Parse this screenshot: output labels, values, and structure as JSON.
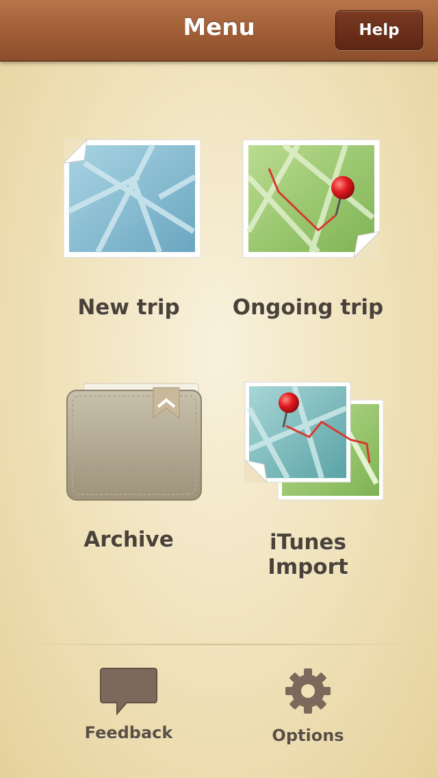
{
  "header": {
    "title": "Menu",
    "help_label": "Help"
  },
  "menu": {
    "new_trip": "New trip",
    "ongoing_trip": "Ongoing trip",
    "archive": "Archive",
    "itunes_import": "iTunes Import"
  },
  "toolbar": {
    "feedback": "Feedback",
    "options": "Options"
  },
  "icons": {
    "new_trip": "blank-map-icon",
    "ongoing_trip": "map-with-pin-icon",
    "archive": "wallet-icon",
    "itunes_import": "stacked-maps-icon",
    "feedback": "speech-bubble-icon",
    "options": "gear-icon"
  },
  "colors": {
    "nav_bar": "#a15f37",
    "help_button": "#6a2e1a",
    "background": "#f3e7c6",
    "route": "#d63a2e",
    "pin": "#e0191f"
  }
}
